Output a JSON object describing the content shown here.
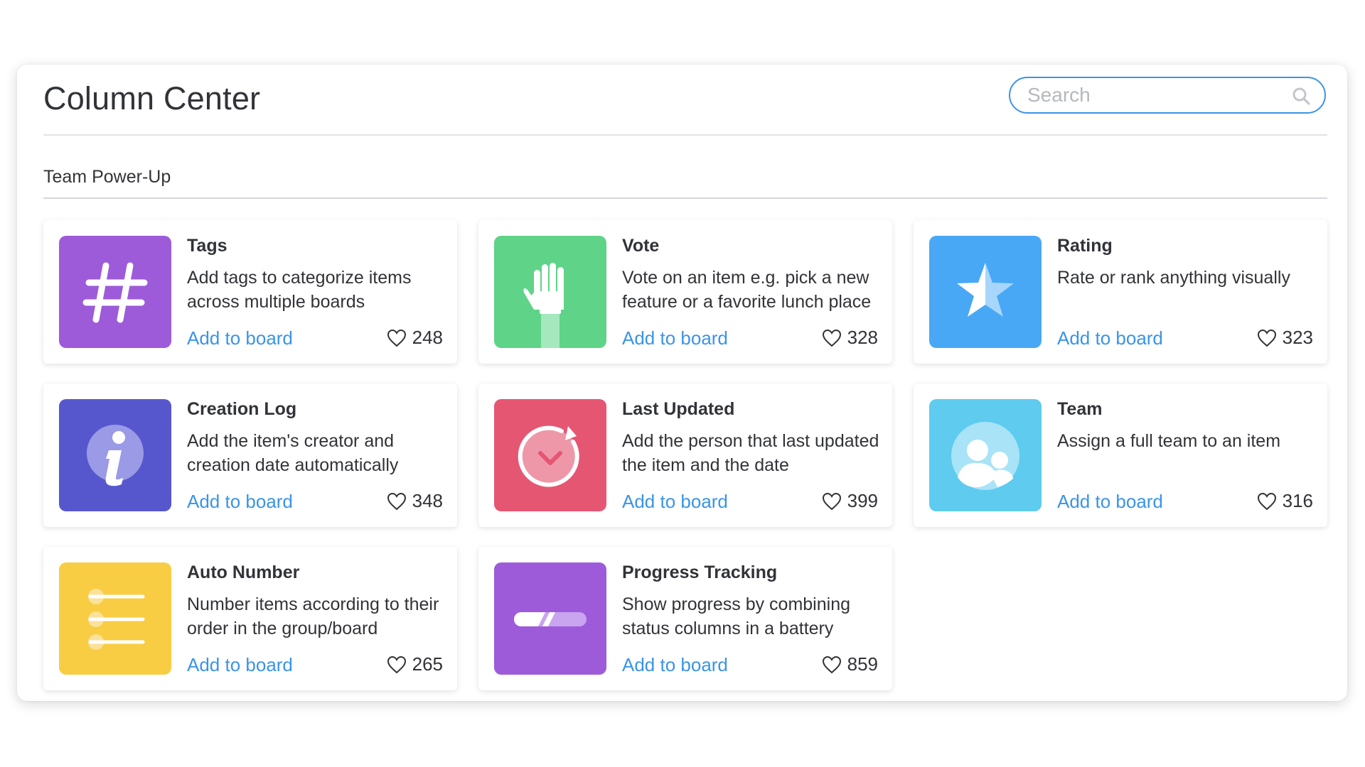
{
  "header": {
    "title": "Column Center",
    "search_placeholder": "Search"
  },
  "section": {
    "title": "Team Power-Up"
  },
  "cards": [
    {
      "title": "Tags",
      "description": "Add tags to categorize items across multiple boards",
      "action": "Add to board",
      "likes": "248",
      "color": "#9d5bd9",
      "icon": "hashtag-icon"
    },
    {
      "title": "Vote",
      "description": "Vote on an item e.g. pick a new feature or a favorite lunch place",
      "action": "Add to board",
      "likes": "328",
      "color": "#5fd387",
      "icon": "raised-hand-icon"
    },
    {
      "title": "Rating",
      "description": "Rate or rank anything visually",
      "action": "Add to board",
      "likes": "323",
      "color": "#48a8f5",
      "icon": "star-icon"
    },
    {
      "title": "Creation Log",
      "description": "Add the item's creator and creation date automatically",
      "action": "Add to board",
      "likes": "348",
      "color": "#5757cd",
      "icon": "info-icon"
    },
    {
      "title": "Last Updated",
      "description": "Add the person that last updated the item and the date",
      "action": "Add to board",
      "likes": "399",
      "color": "#e55672",
      "icon": "clock-refresh-icon"
    },
    {
      "title": "Team",
      "description": "Assign a full team to an item",
      "action": "Add to board",
      "likes": "316",
      "color": "#5ecbef",
      "icon": "team-icon"
    },
    {
      "title": "Auto Number",
      "description": "Number items according to their order in the group/board",
      "action": "Add to board",
      "likes": "265",
      "color": "#f8cd44",
      "icon": "numbered-list-icon"
    },
    {
      "title": "Progress Tracking",
      "description": "Show progress by combining status columns in a battery",
      "action": "Add to board",
      "likes": "859",
      "color": "#9d5bd9",
      "icon": "progress-bar-icon"
    }
  ],
  "colors": {
    "accent": "#3a94e8",
    "text": "#323338"
  }
}
